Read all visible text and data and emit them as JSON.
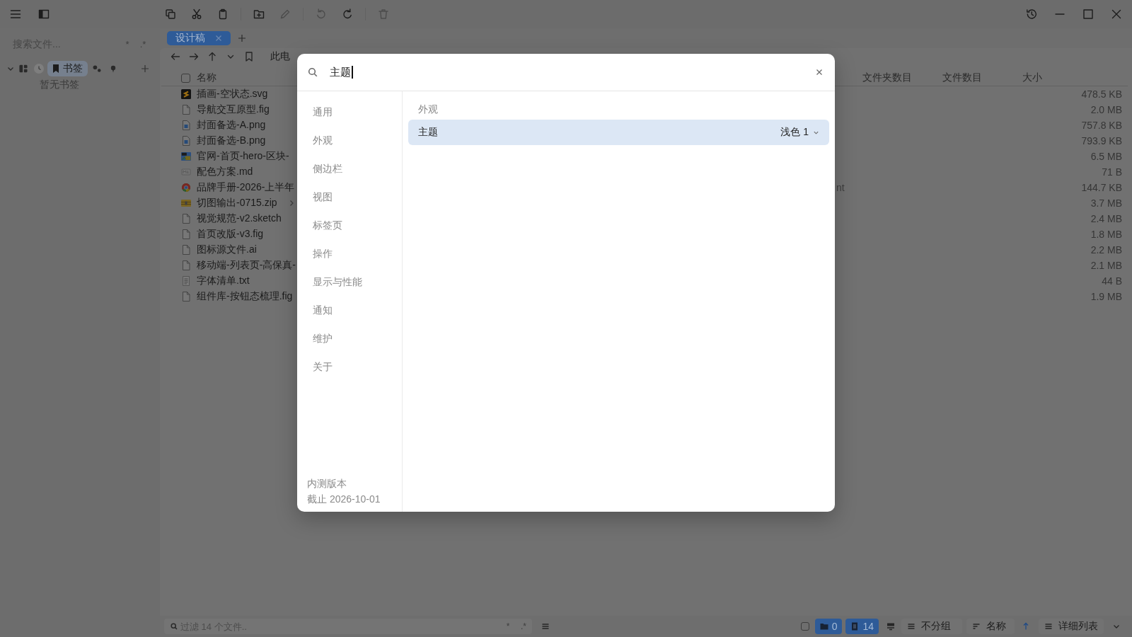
{
  "toolbar": [
    {
      "disabled": false
    },
    {
      "disabled": false
    },
    {
      "disabled": false
    },
    {
      "disabled": false
    },
    {
      "disabled": true
    },
    {
      "disabled": true
    },
    {
      "disabled": false
    },
    {
      "disabled": true
    }
  ],
  "sidebar": {
    "search": {
      "placeholder": "搜索文件..."
    },
    "search_options": [
      "*",
      ".*"
    ],
    "tabs": [
      {
        "selected": false
      },
      {
        "selected": false
      },
      {
        "label": "书签",
        "selected": true
      },
      {
        "selected": false
      },
      {
        "selected": false
      }
    ],
    "empty_message": "暂无书签"
  },
  "tabs": [
    {
      "label": "设计稿",
      "selected": true
    }
  ],
  "breadcrumb": [
    "此电"
  ],
  "table": {
    "select_all": {
      "checked": false
    },
    "columns": [
      "名称",
      "文件夹数目",
      "文件数目",
      "大小"
    ],
    "rows": [
      {
        "kind": "vector",
        "name": "插画-空状态.svg",
        "size": "478.5 KB",
        "expandable": false
      },
      {
        "kind": "document",
        "name": "导航交互原型.fig",
        "size": "2.0 MB",
        "expandable": false
      },
      {
        "kind": "image",
        "name": "封面备选-A.png",
        "size": "757.8 KB",
        "expandable": false
      },
      {
        "kind": "image",
        "name": "封面备选-B.png",
        "size": "793.9 KB",
        "expandable": false
      },
      {
        "kind": "picture",
        "name": "官网-首页-hero-区块-",
        "size": "6.5 MB",
        "expandable": false
      },
      {
        "kind": "markdown",
        "name": "配色方案.md",
        "size": "71 B",
        "expandable": false
      },
      {
        "kind": "web",
        "name": "品牌手册-2026-上半年",
        "column_2": "nt",
        "size": "144.7 KB",
        "expandable": false
      },
      {
        "kind": "archive",
        "name": "切图输出-0715.zip",
        "size": "3.7 MB",
        "expandable": true
      },
      {
        "kind": "document",
        "name": "视觉规范-v2.sketch",
        "size": "2.4 MB",
        "expandable": false
      },
      {
        "kind": "document",
        "name": "首页改版-v3.fig",
        "size": "1.8 MB",
        "expandable": false
      },
      {
        "kind": "document",
        "name": "图标源文件.ai",
        "size": "2.2 MB",
        "expandable": false
      },
      {
        "kind": "document",
        "name": "移动端-列表页-高保真-",
        "size": "2.1 MB",
        "expandable": false
      },
      {
        "kind": "text",
        "name": "字体清单.txt",
        "size": "44 B",
        "expandable": false
      },
      {
        "kind": "document",
        "name": "组件库-按钮态梳理.fig",
        "size": "1.9 MB",
        "expandable": false
      }
    ]
  },
  "status_bar": {
    "filter": {
      "placeholder": "过滤 14 个文件.."
    },
    "filter_options": [
      "*",
      ".*"
    ],
    "select_mode": {
      "checked": false
    },
    "folder_count": {
      "label": "0",
      "on": true
    },
    "file_count": {
      "label": "14",
      "on": true
    },
    "group": "不分组",
    "sort": "名称",
    "sort_ascending": true,
    "view": "详细列表"
  },
  "dialog": {
    "search": {
      "value": "主题"
    },
    "nav": [
      {
        "label": "通用",
        "selected": false
      },
      {
        "label": "外观",
        "selected": false
      },
      {
        "label": "侧边栏",
        "selected": false
      },
      {
        "label": "视图",
        "selected": false
      },
      {
        "label": "标签页",
        "selected": false
      },
      {
        "label": "操作",
        "selected": false
      },
      {
        "label": "显示与性能",
        "selected": false
      },
      {
        "label": "通知",
        "selected": false
      },
      {
        "label": "维护",
        "selected": false
      },
      {
        "label": "关于",
        "selected": false
      }
    ],
    "footer": [
      "内测版本",
      "截止 2026-10-01"
    ],
    "results": {
      "section": "外观",
      "items": [
        {
          "label": "主题",
          "value": "浅色 1",
          "selected": true
        }
      ]
    }
  }
}
